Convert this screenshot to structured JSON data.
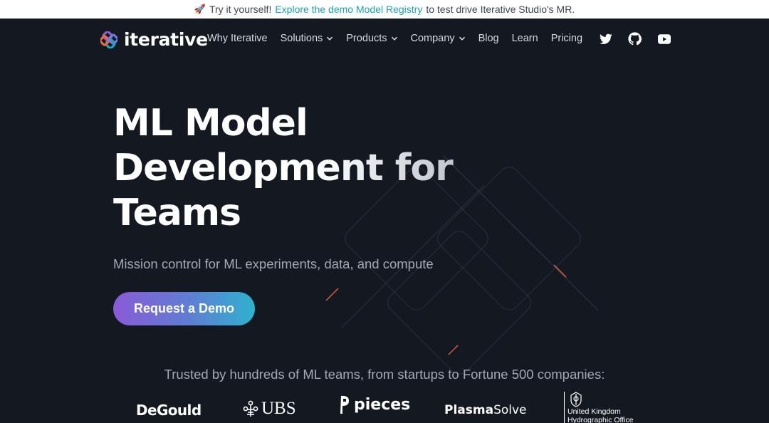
{
  "announcement": {
    "prefix": "Try it yourself!",
    "link_text": "Explore the demo Model Registry",
    "suffix": "to test drive Iterative Studio's MR.",
    "rocket_icon": "rocket-icon"
  },
  "nav": {
    "brand": "iterative",
    "items": [
      {
        "label": "Why Iterative",
        "dropdown": false
      },
      {
        "label": "Solutions",
        "dropdown": true
      },
      {
        "label": "Products",
        "dropdown": true
      },
      {
        "label": "Company",
        "dropdown": true
      },
      {
        "label": "Blog",
        "dropdown": false
      },
      {
        "label": "Learn",
        "dropdown": false
      },
      {
        "label": "Pricing",
        "dropdown": false
      }
    ],
    "socials": [
      "twitter-icon",
      "github-icon",
      "youtube-icon"
    ]
  },
  "hero": {
    "title_line1": "ML Model",
    "title_line2": "Development for",
    "title_line3": "Teams",
    "subtitle": "Mission control for ML experiments, data, and compute",
    "cta_label": "Request a Demo"
  },
  "trusted": {
    "heading": "Trusted by hundreds of ML teams, from startups to Fortune 500 companies:",
    "logos": {
      "degould": "DeGould",
      "ubs": "UBS",
      "pieces": "pieces",
      "plasma_bold": "Plasma",
      "plasma_regular": "Solve",
      "ukho_line1": "United Kingdom",
      "ukho_line2": "Hydrographic Office"
    }
  },
  "colors": {
    "background": "#141821",
    "accent_link": "#1aa3b8",
    "cta_start": "#8a5ad6",
    "cta_end": "#2fb2cd"
  }
}
